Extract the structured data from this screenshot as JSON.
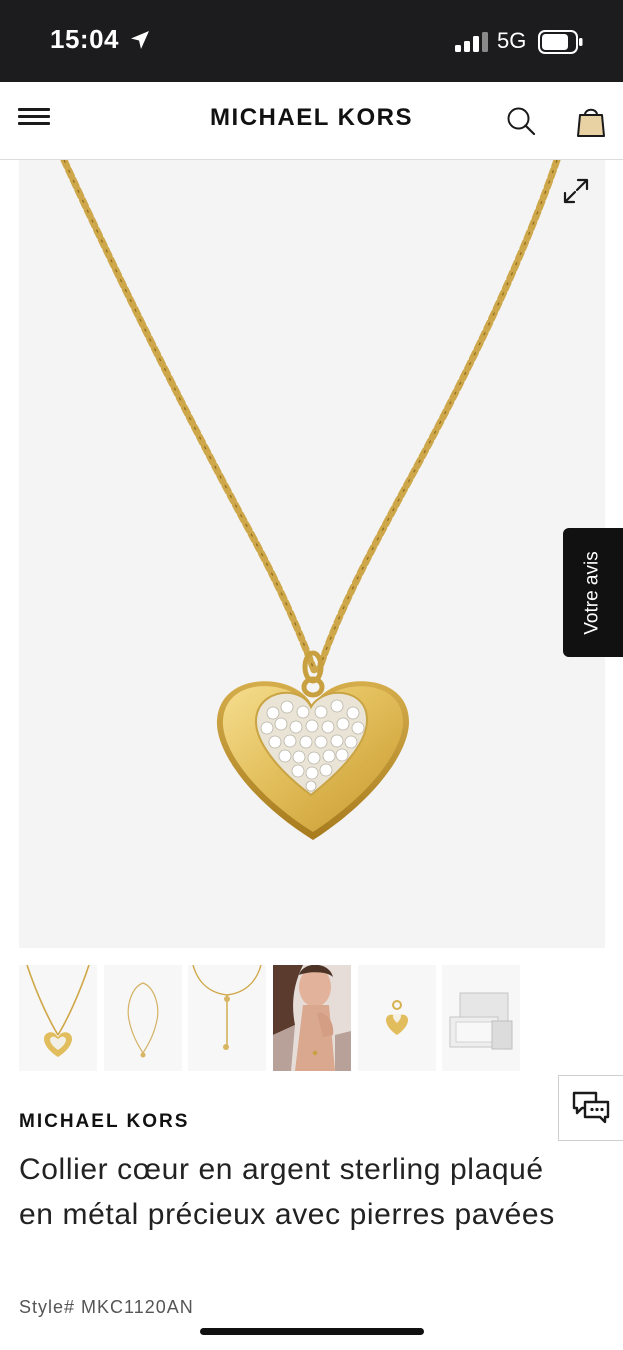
{
  "status_bar": {
    "time": "15:04",
    "network": "5G",
    "icons": [
      "location-arrow-icon",
      "signal-bars-icon",
      "battery-icon"
    ]
  },
  "header": {
    "brand": "MICHAEL KORS",
    "icons": [
      "menu-icon",
      "search-icon",
      "shopping-bag-icon"
    ]
  },
  "gallery": {
    "main_image": "heart-pendant-necklace",
    "expand_icon": "expand-icon",
    "thumbnails": [
      {
        "name": "thumb-heart-pendant",
        "selected": true
      },
      {
        "name": "thumb-full-necklace",
        "selected": false
      },
      {
        "name": "thumb-adjustable-chain",
        "selected": false
      },
      {
        "name": "thumb-model-wearing",
        "selected": false
      },
      {
        "name": "thumb-pendant-detail",
        "selected": false
      },
      {
        "name": "thumb-gift-box",
        "selected": false
      }
    ]
  },
  "feedback_tab": {
    "label": "Votre avis"
  },
  "chat": {
    "icon": "chat-bubbles-icon"
  },
  "product": {
    "brand": "MICHAEL KORS",
    "title": "Collier cœur en argent sterling plaqué en métal précieux avec pierres pavées",
    "style": "Style# MKC1120AN"
  },
  "colors": {
    "status_bar_bg": "#1c1c1e",
    "gold": "#d9b24a",
    "image_bg": "#f4f4f4",
    "text": "#222222"
  }
}
